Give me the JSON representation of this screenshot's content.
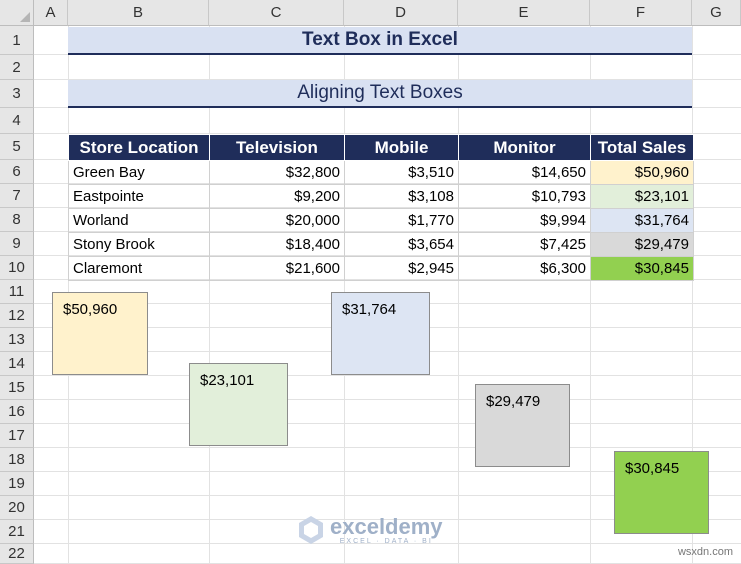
{
  "columns": [
    "A",
    "B",
    "C",
    "D",
    "E",
    "F",
    "G"
  ],
  "rows": [
    "1",
    "2",
    "3",
    "4",
    "5",
    "6",
    "7",
    "8",
    "9",
    "10",
    "11",
    "12",
    "13",
    "14",
    "15",
    "16",
    "17",
    "18",
    "19",
    "20",
    "21",
    "22"
  ],
  "title": "Text Box in Excel",
  "subtitle": "Aligning Text Boxes",
  "table": {
    "headers": [
      "Store Location",
      "Television",
      "Mobile",
      "Monitor",
      "Total Sales"
    ],
    "rows": [
      [
        "Green Bay",
        "$32,800",
        "$3,510",
        "$14,650",
        "$50,960"
      ],
      [
        "Eastpointe",
        "$9,200",
        "$3,108",
        "$10,793",
        "$23,101"
      ],
      [
        "Worland",
        "$20,000",
        "$1,770",
        "$9,994",
        "$31,764"
      ],
      [
        "Stony Brook",
        "$18,400",
        "$3,654",
        "$7,425",
        "$29,479"
      ],
      [
        "Claremont",
        "$21,600",
        "$2,945",
        "$6,300",
        "$30,845"
      ]
    ],
    "total_colors": [
      "#fff2cc",
      "#e2efda",
      "#dde5f3",
      "#d9d9d9",
      "#92d050"
    ]
  },
  "text_boxes": [
    {
      "value": "$50,960",
      "color": "#fff2cc"
    },
    {
      "value": "$23,101",
      "color": "#e2efda"
    },
    {
      "value": "$31,764",
      "color": "#dde5f3"
    },
    {
      "value": "$29,479",
      "color": "#d9d9d9"
    },
    {
      "value": "$30,845",
      "color": "#92d050"
    }
  ],
  "logo": {
    "name": "exceldemy",
    "tagline": "EXCEL · DATA · BI"
  },
  "watermark": "wsxdn.com"
}
